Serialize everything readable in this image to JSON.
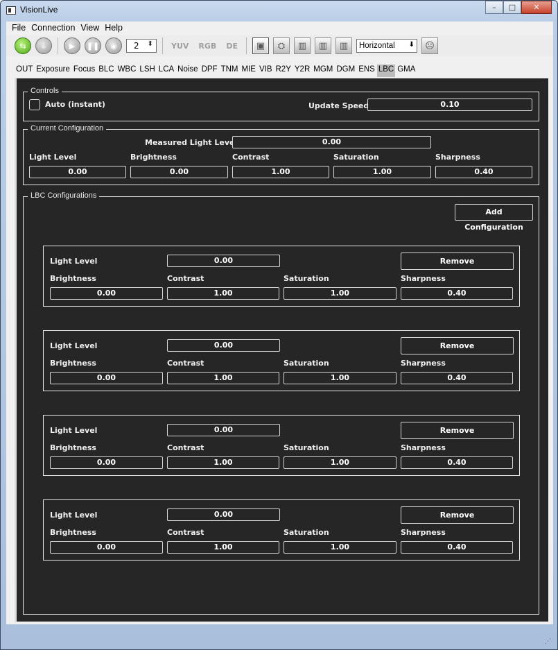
{
  "window": {
    "title": "VisionLive",
    "minimize": "–",
    "maximize": "□",
    "close": "✕"
  },
  "menu": [
    "File",
    "Connection",
    "View",
    "Help"
  ],
  "toolbar": {
    "spin_value": "2",
    "mode_labels": [
      "YUV",
      "RGB",
      "DE"
    ],
    "layout_select": "Horizontal"
  },
  "tabs": [
    "OUT",
    "Exposure",
    "Focus",
    "BLC",
    "WBC",
    "LSH",
    "LCA",
    "Noise",
    "DPF",
    "TNM",
    "MIE",
    "VIB",
    "R2Y",
    "Y2R",
    "MGM",
    "DGM",
    "ENS",
    "LBC",
    "GMA"
  ],
  "active_tab": "LBC",
  "controls": {
    "title": "Controls",
    "auto_label": "Auto (instant)",
    "update_speed_label": "Update Speed",
    "update_speed_value": "0.10"
  },
  "current": {
    "title": "Current Configuration",
    "measured_label": "Measured Light Level",
    "measured_value": "0.00",
    "labels": [
      "Light Level",
      "Brightness",
      "Contrast",
      "Saturation",
      "Sharpness"
    ],
    "values": [
      "0.00",
      "0.00",
      "1.00",
      "1.00",
      "0.40"
    ]
  },
  "lbc": {
    "title": "LBC Configurations",
    "add_button": "Add Configuration",
    "labels": {
      "light": "Light Level",
      "brightness": "Brightness",
      "contrast": "Contrast",
      "saturation": "Saturation",
      "sharpness": "Sharpness"
    },
    "remove_label": "Remove",
    "configs": [
      {
        "light": "0.00",
        "brightness": "0.00",
        "contrast": "1.00",
        "saturation": "1.00",
        "sharpness": "0.40"
      },
      {
        "light": "0.00",
        "brightness": "0.00",
        "contrast": "1.00",
        "saturation": "1.00",
        "sharpness": "0.40"
      },
      {
        "light": "0.00",
        "brightness": "0.00",
        "contrast": "1.00",
        "saturation": "1.00",
        "sharpness": "0.40"
      },
      {
        "light": "0.00",
        "brightness": "0.00",
        "contrast": "1.00",
        "saturation": "1.00",
        "sharpness": "0.40"
      }
    ]
  }
}
